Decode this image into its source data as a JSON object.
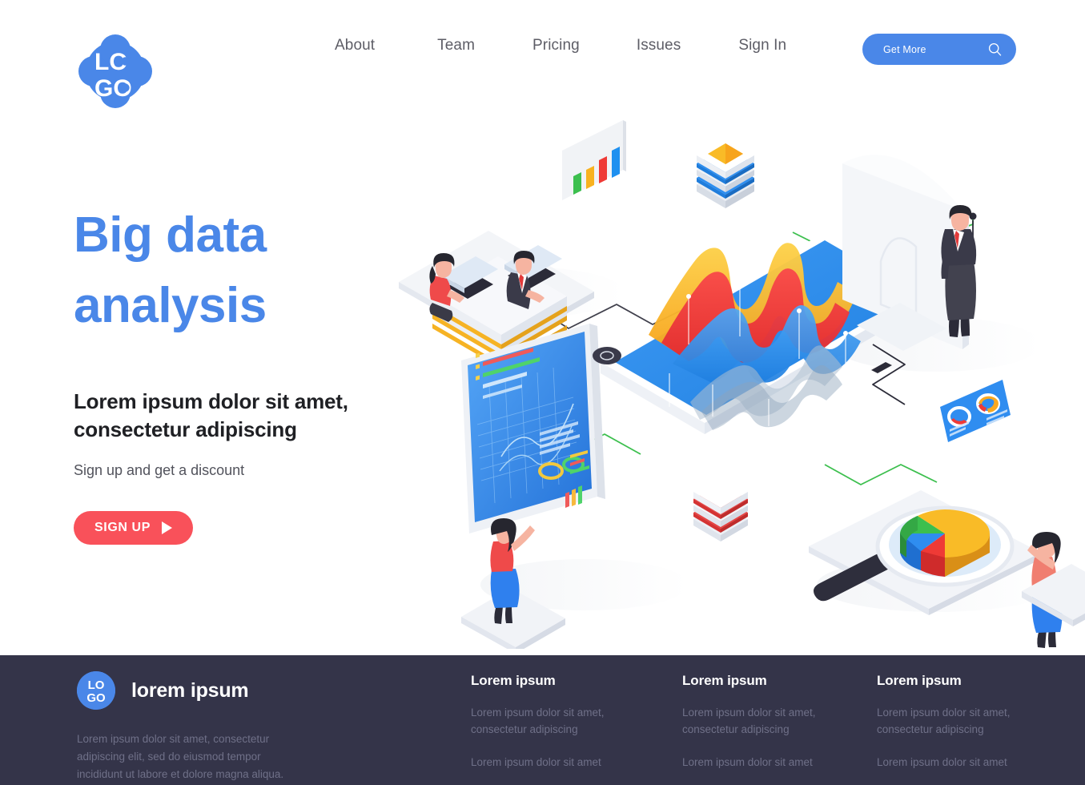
{
  "header": {
    "logo": {
      "line1": "LO",
      "line2": "GO",
      "icon": "logo-icon",
      "color": "#4a87e8"
    },
    "nav": [
      {
        "label": "About"
      },
      {
        "label": "Team"
      },
      {
        "label": "Pricing"
      },
      {
        "label": "Issues"
      },
      {
        "label": "Sign In"
      }
    ],
    "cta": {
      "label": "Get More",
      "icon": "search-icon",
      "bg": "#4a87e8",
      "text_color": "#ffffff"
    }
  },
  "hero": {
    "title_line1": "Big data",
    "title_line2": "analysis",
    "title_color": "#4a87e8",
    "subtitle_line1": "Lorem ipsum dolor sit amet,",
    "subtitle_line2": "consectetur adipiscing",
    "note": "Sign up and get a discount",
    "button": {
      "label": "SIGN UP",
      "icon": "play-icon",
      "bg": "#f9515a",
      "text_color": "#ffffff"
    }
  },
  "illustration": {
    "name": "big-data-isometric-illustration",
    "elements": [
      {
        "name": "bar-chart-panel",
        "bars": [
          "#3cbf4e",
          "#f8b21f",
          "#ef3a36",
          "#1e90f0"
        ]
      },
      {
        "name": "data-stack-blue",
        "top_color": "#f9bb27",
        "layer_color": "#2d8ef0"
      },
      {
        "name": "data-stack-red",
        "layer_color": "#e8403f"
      },
      {
        "name": "desk-workers",
        "count": 2
      },
      {
        "name": "dashboard-monitor",
        "screen_color": "#2f8df0"
      },
      {
        "name": "tablet-wave-chart",
        "wave_colors": [
          "#fcc13c",
          "#ef3a36",
          "#2f8df0"
        ]
      },
      {
        "name": "desktop-monitor-back",
        "worker": "businessman"
      },
      {
        "name": "donut-card",
        "bg": "#2f8df0",
        "donuts": [
          "#ef3a36",
          "#f9a81f"
        ]
      },
      {
        "name": "pie-chart-magnifier",
        "slices": [
          "#f9bb27",
          "#3cbf4e",
          "#2f8df0",
          "#ef3a36"
        ]
      },
      {
        "name": "connector-lines",
        "colors": [
          "#3cbf4e",
          "#2b2b38"
        ]
      }
    ]
  },
  "footer": {
    "bg": "#343449",
    "brand": {
      "logo_line1": "LO",
      "logo_line2": "GO",
      "name": "lorem ipsum",
      "description": "Lorem ipsum dolor sit amet, consectetur adipiscing elit, sed do eiusmod tempor incididunt ut labore et dolore magna aliqua."
    },
    "columns": [
      {
        "heading": "Lorem ipsum",
        "links": [
          "Lorem ipsum dolor sit amet, consectetur adipiscing",
          "Lorem ipsum dolor sit amet"
        ]
      },
      {
        "heading": "Lorem ipsum",
        "links": [
          "Lorem ipsum dolor sit amet, consectetur adipiscing",
          "Lorem ipsum dolor sit amet"
        ]
      },
      {
        "heading": "Lorem ipsum",
        "links": [
          "Lorem ipsum dolor sit amet, consectetur adipiscing",
          "Lorem ipsum dolor sit amet"
        ]
      }
    ]
  }
}
